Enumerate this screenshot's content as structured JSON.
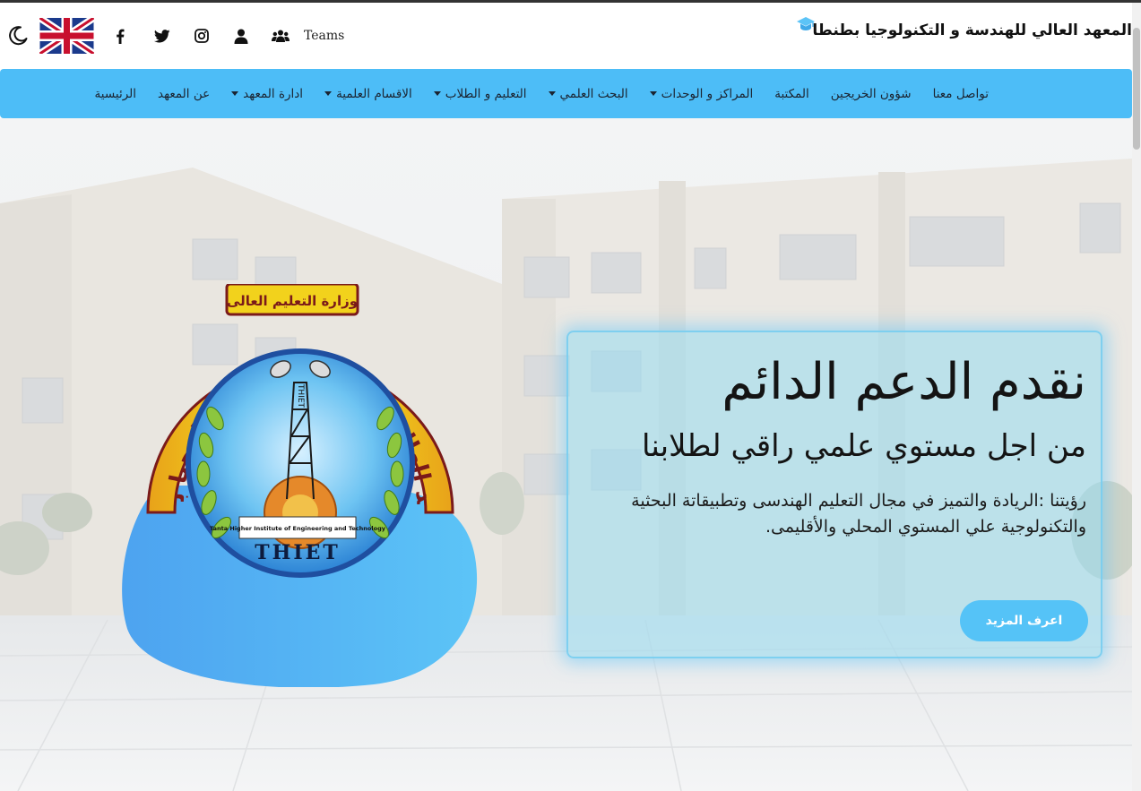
{
  "header": {
    "title": "المعهد العالي للهندسة و التكنولوجيا بطنطا",
    "teams_label": "Teams",
    "icons": [
      "graduation-cap-icon",
      "moon-icon",
      "uk-flag-icon",
      "facebook-icon",
      "twitter-icon",
      "instagram-icon",
      "user-icon",
      "users-icon"
    ]
  },
  "nav": {
    "items": [
      {
        "label": "الرئيسية",
        "dropdown": false
      },
      {
        "label": "عن المعهد",
        "dropdown": false
      },
      {
        "label": "ادارة المعهد",
        "dropdown": true
      },
      {
        "label": "الاقسام العلمية",
        "dropdown": true
      },
      {
        "label": "التعليم و الطلاب",
        "dropdown": true
      },
      {
        "label": "البحث العلمي",
        "dropdown": true
      },
      {
        "label": "المراكز و الوحدات",
        "dropdown": true
      },
      {
        "label": "المكتبة",
        "dropdown": false
      },
      {
        "label": "شؤون الخريجين",
        "dropdown": false
      },
      {
        "label": "تواصل معنا",
        "dropdown": false
      }
    ]
  },
  "hero": {
    "heading": "نقدم الدعم الدائم",
    "subheading": "من اجل مستوي علمي راقي لطلابنا",
    "vision": "رؤيتنا :الريادة والتميز في مجال التعليم الهندسى وتطبيقاتة البحثية والتكنولوجية علي المستوي المحلي والأقليمى.",
    "button_label": "اعرف المزيد"
  },
  "emblem": {
    "top_text": "وزارة التعليم العالى",
    "arc_text": "المعهد العالى للهندسة و التكنولوجيا بطنطا",
    "english_text": "Tanta Higher Institute of Engineering and Technology",
    "abbr": "THIET",
    "tower_letters": "THIET"
  },
  "colors": {
    "nav_bg": "#4dbdf7",
    "button_bg": "#55c3f7",
    "panel_bg": "rgba(150,218,240,0.55)",
    "blob_from": "#4da3f0",
    "blob_to": "#5cc4f7"
  }
}
